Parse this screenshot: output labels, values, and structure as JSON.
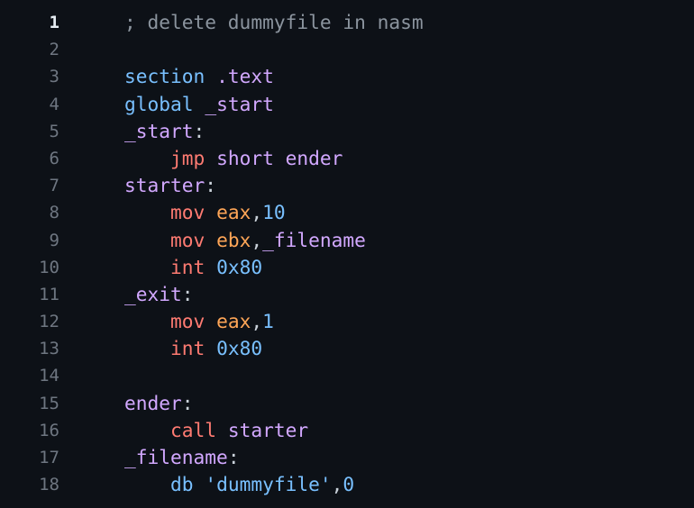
{
  "active_line": 1,
  "lines": [
    {
      "n": "1",
      "tokens": [
        [
          "; delete dummyfile in nasm",
          "comment"
        ]
      ]
    },
    {
      "n": "2",
      "tokens": []
    },
    {
      "n": "3",
      "tokens": [
        [
          "section",
          "dir"
        ],
        [
          " ",
          "plain"
        ],
        [
          ".text",
          "label"
        ]
      ]
    },
    {
      "n": "4",
      "tokens": [
        [
          "global",
          "dir"
        ],
        [
          " ",
          "plain"
        ],
        [
          "_start",
          "label"
        ]
      ]
    },
    {
      "n": "5",
      "tokens": [
        [
          "_start",
          "label"
        ],
        [
          ":",
          "plain"
        ]
      ]
    },
    {
      "n": "6",
      "tokens": [
        [
          "    ",
          "plain"
        ],
        [
          "jmp",
          "kw"
        ],
        [
          " ",
          "plain"
        ],
        [
          "short ender",
          "label"
        ]
      ]
    },
    {
      "n": "7",
      "tokens": [
        [
          "starter",
          "label"
        ],
        [
          ":",
          "plain"
        ]
      ]
    },
    {
      "n": "8",
      "tokens": [
        [
          "    ",
          "plain"
        ],
        [
          "mov",
          "kw"
        ],
        [
          " ",
          "plain"
        ],
        [
          "eax",
          "reg"
        ],
        [
          ",",
          "plain"
        ],
        [
          "10",
          "num"
        ]
      ]
    },
    {
      "n": "9",
      "tokens": [
        [
          "    ",
          "plain"
        ],
        [
          "mov",
          "kw"
        ],
        [
          " ",
          "plain"
        ],
        [
          "ebx",
          "reg"
        ],
        [
          ",",
          "plain"
        ],
        [
          "_filename",
          "label"
        ]
      ]
    },
    {
      "n": "10",
      "tokens": [
        [
          "    ",
          "plain"
        ],
        [
          "int",
          "kw"
        ],
        [
          " ",
          "plain"
        ],
        [
          "0x80",
          "num"
        ]
      ]
    },
    {
      "n": "11",
      "tokens": [
        [
          "_exit",
          "label"
        ],
        [
          ":",
          "plain"
        ]
      ]
    },
    {
      "n": "12",
      "tokens": [
        [
          "    ",
          "plain"
        ],
        [
          "mov",
          "kw"
        ],
        [
          " ",
          "plain"
        ],
        [
          "eax",
          "reg"
        ],
        [
          ",",
          "plain"
        ],
        [
          "1",
          "num"
        ]
      ]
    },
    {
      "n": "13",
      "tokens": [
        [
          "    ",
          "plain"
        ],
        [
          "int",
          "kw"
        ],
        [
          " ",
          "plain"
        ],
        [
          "0x80",
          "num"
        ]
      ]
    },
    {
      "n": "14",
      "tokens": []
    },
    {
      "n": "15",
      "tokens": [
        [
          "ender",
          "label"
        ],
        [
          ":",
          "plain"
        ]
      ]
    },
    {
      "n": "16",
      "tokens": [
        [
          "    ",
          "plain"
        ],
        [
          "call",
          "kw"
        ],
        [
          " ",
          "plain"
        ],
        [
          "starter",
          "label"
        ]
      ]
    },
    {
      "n": "17",
      "tokens": [
        [
          "_filename",
          "label"
        ],
        [
          ":",
          "plain"
        ]
      ]
    },
    {
      "n": "18",
      "tokens": [
        [
          "    ",
          "plain"
        ],
        [
          "db",
          "dir"
        ],
        [
          " ",
          "plain"
        ],
        [
          "'dummyfile'",
          "str"
        ],
        [
          ",",
          "plain"
        ],
        [
          "0",
          "num"
        ]
      ]
    }
  ]
}
